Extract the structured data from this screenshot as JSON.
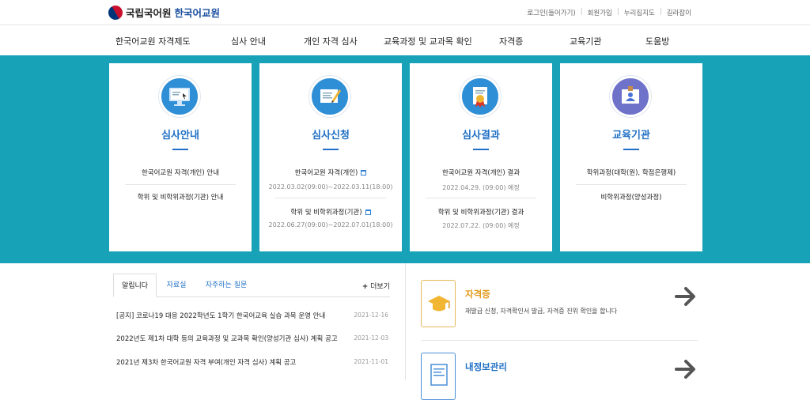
{
  "header": {
    "logo_org": "국립국어원",
    "logo_site": "한국어교원",
    "util": [
      "로그인(들어가기)",
      "회원가입",
      "누리집지도",
      "길라잡이"
    ]
  },
  "gnb": [
    "한국어교원 자격제도",
    "심사 안내",
    "개인 자격 심사",
    "교육과정 및 교과목 확인",
    "자격증",
    "교육기관",
    "도움방"
  ],
  "cards": [
    {
      "title": "심사안내",
      "lines": [
        "한국어교원 자격(개인) 안내",
        "학위 및 비학위과정(기관) 안내"
      ]
    },
    {
      "title": "심사신청",
      "lines": [
        "한국어교원 자격(개인)",
        "2022.03.02(09:00)~2022.03.11(18:00)",
        "학위 및 비학위과정(기관)",
        "2022.06.27(09:00)~2022.07.01(18:00)"
      ]
    },
    {
      "title": "심사결과",
      "lines": [
        "한국어교원 자격(개인) 결과",
        "2022.04.29. (09:00) 예정",
        "학위 및 비학위과정(기관) 결과",
        "2022.07.22. (09:00) 예정"
      ]
    },
    {
      "title": "교육기관",
      "lines": [
        "학위과정(대학(원), 학점은행제)",
        "비학위과정(양성과정)"
      ]
    }
  ],
  "notice": {
    "tabs": [
      "알립니다",
      "자료실",
      "자주하는 질문"
    ],
    "more": "더보기",
    "items": [
      {
        "title": "[공지] 코로나19 대응 2022학년도 1학기 한국어교육 실습 과목 운영 안내",
        "date": "2021-12-16"
      },
      {
        "title": "2022년도 제1차 대학 등의 교육과정 및 교과목 확인(양성기관 심사) 계획 공고",
        "date": "2021-12-03"
      },
      {
        "title": "2021년 제3차 한국어교원 자격 부여(개인 자격 심사) 계획 공고",
        "date": "2021-11-01"
      }
    ]
  },
  "services": [
    {
      "title": "자격증",
      "desc": "재발급 신청, 자격확인서 발급, 자격증 진위 확인을 합니다",
      "color": "#e29b1c"
    },
    {
      "title": "내정보관리",
      "desc": "",
      "color": "#1f6fc5"
    }
  ]
}
